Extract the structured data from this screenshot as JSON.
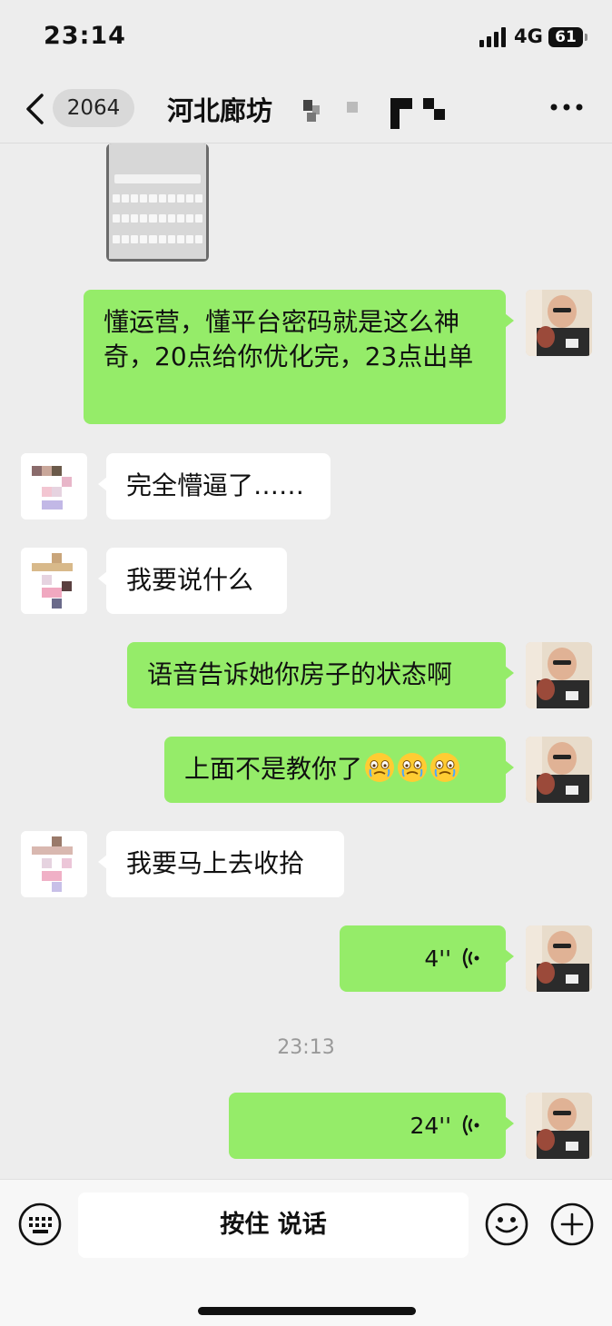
{
  "status_bar": {
    "time": "23:14",
    "network": "4G",
    "battery": "61"
  },
  "nav": {
    "unread_count": "2064",
    "title": "河北廊坊"
  },
  "messages": [
    {
      "side": "out",
      "text": "懂运营，懂平台密码就是这么神奇，20点给你优化完，23点出单"
    },
    {
      "side": "in",
      "text": "完全懵逼了……"
    },
    {
      "side": "in",
      "text": "我要说什么"
    },
    {
      "side": "out",
      "text": "语音告诉她你房子的状态啊"
    },
    {
      "side": "out",
      "text": "上面不是教你了",
      "emoji": [
        "crying-face",
        "crying-face",
        "crying-face"
      ]
    },
    {
      "side": "in",
      "text": "我要马上去收拾"
    },
    {
      "side": "out",
      "voice_duration": "4''"
    },
    {
      "side": "out",
      "voice_duration": "24''"
    }
  ],
  "timestamp": "23:13",
  "input_bar": {
    "hold_to_talk": "按住 说话"
  },
  "icons": [
    "back-icon",
    "more-icon",
    "keyboard-icon",
    "emoji-icon",
    "plus-icon",
    "voice-wave-icon",
    "signal-icon",
    "battery-icon"
  ],
  "colors": {
    "outgoing_bubble": "#95ec69",
    "incoming_bubble": "#ffffff",
    "background": "#ededed"
  }
}
